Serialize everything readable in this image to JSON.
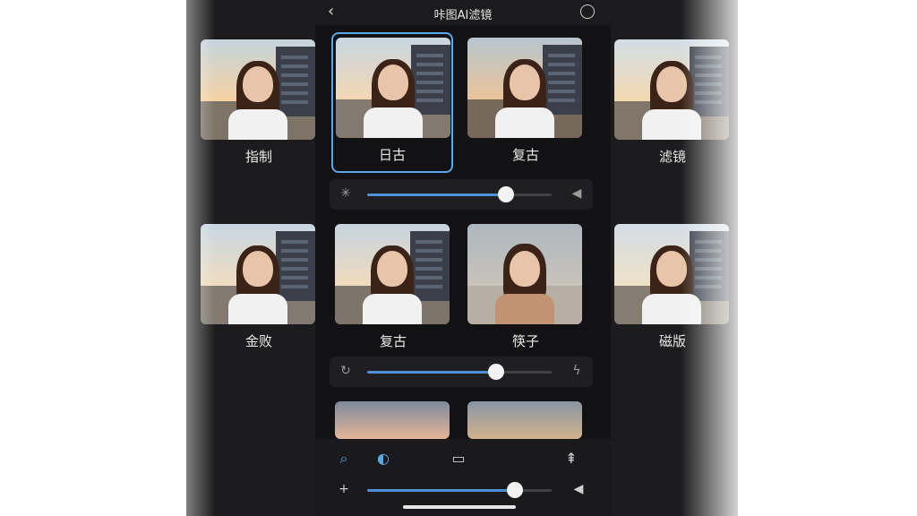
{
  "header": {
    "back_icon": "chevron-left-icon",
    "title": "咔图AI滤镜",
    "action_icon": "circle-icon"
  },
  "left_column": {
    "label_1": "指制",
    "label_2": "金败"
  },
  "right_column": {
    "label_1": "滤镜",
    "label_2": "磁版"
  },
  "row1": [
    {
      "label": "日古",
      "selected": true
    },
    {
      "label": "复古",
      "selected": false
    }
  ],
  "slider1": {
    "left_icon": "sparkle-icon",
    "right_icon": "speaker-icon",
    "value_percent": 75
  },
  "row2": [
    {
      "label": "复古"
    },
    {
      "label": "筷子"
    }
  ],
  "slider2": {
    "left_icon": "rotate-icon",
    "right_icon": "lightning-icon",
    "value_percent": 70
  },
  "bottom_toolbar": {
    "icons": [
      "search-icon",
      "shield-icon",
      "screen-icon",
      "adjust-icon"
    ],
    "slider": {
      "left_icon": "plus-icon",
      "right_icon": "speaker-icon",
      "value_percent": 80
    }
  },
  "colors": {
    "accent": "#4f8fd8",
    "selected_border": "#5aa7e6",
    "bg": "#121214"
  }
}
